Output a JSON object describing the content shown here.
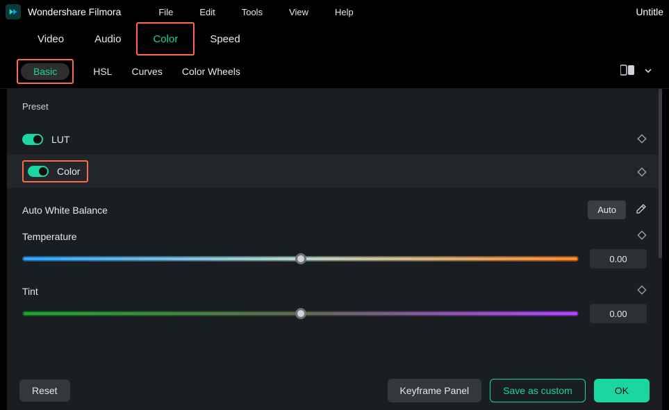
{
  "app": {
    "name": "Wondershare Filmora",
    "doc": "Untitle"
  },
  "menu": [
    "File",
    "Edit",
    "Tools",
    "View",
    "Help"
  ],
  "maintabs": {
    "items": [
      "Video",
      "Audio",
      "Color",
      "Speed"
    ],
    "active": 2
  },
  "subtabs": {
    "items": [
      "Basic",
      "HSL",
      "Curves",
      "Color Wheels"
    ],
    "active": 0
  },
  "panel": {
    "preset_label": "Preset",
    "lut": {
      "label": "LUT",
      "on": true
    },
    "color": {
      "label": "Color",
      "on": true
    },
    "awb": {
      "label": "Auto White Balance",
      "auto_btn": "Auto"
    },
    "temperature": {
      "label": "Temperature",
      "value": "0.00"
    },
    "tint": {
      "label": "Tint",
      "value": "0.00"
    }
  },
  "footer": {
    "reset": "Reset",
    "keyframe": "Keyframe Panel",
    "save": "Save as custom",
    "ok": "OK"
  }
}
